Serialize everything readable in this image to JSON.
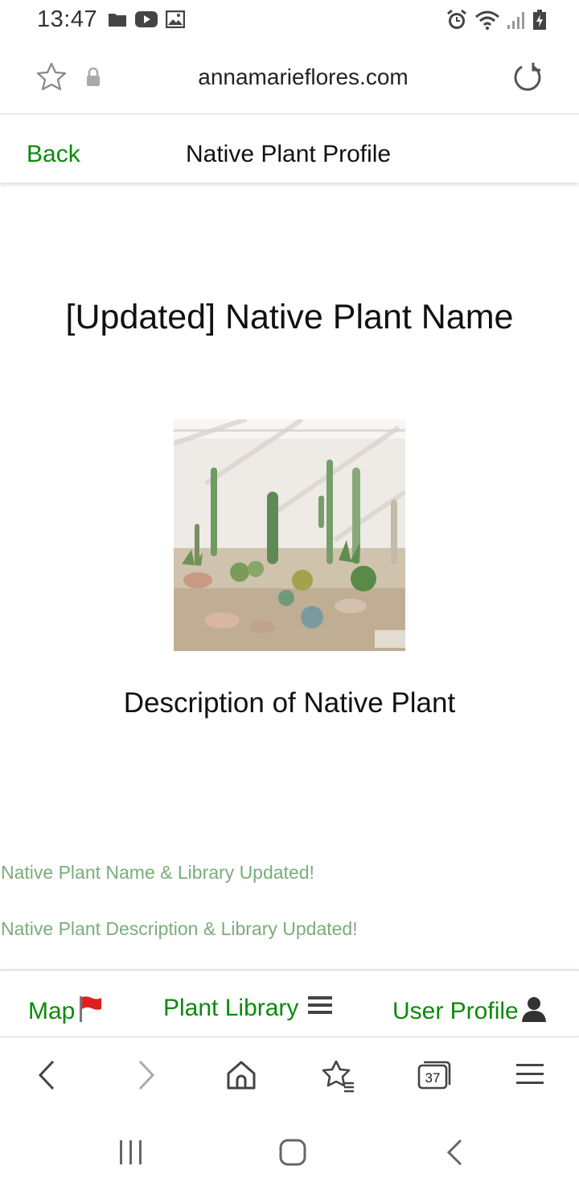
{
  "status_bar": {
    "time": "13:47",
    "left_icons": [
      "folder-icon",
      "youtube-icon",
      "image-icon"
    ],
    "right_icons": [
      "alarm-icon",
      "wifi-icon",
      "signal-icon",
      "battery-charging-icon"
    ]
  },
  "browser": {
    "url": "annamarieflores.com",
    "tab_count": "37"
  },
  "header": {
    "back_label": "Back",
    "title": "Native Plant Profile"
  },
  "main": {
    "plant_name": "[Updated] Native Plant Name",
    "description": "Description of Native Plant",
    "messages": [
      "Native Plant Name & Library Updated!",
      "Native Plant Description & Library Updated!"
    ]
  },
  "app_nav": {
    "items": [
      {
        "label": "Map",
        "icon": "red-flag-icon"
      },
      {
        "label": "Plant Library",
        "icon": "hamburger-icon"
      },
      {
        "label": "User Profile",
        "icon": "user-silhouette-icon"
      }
    ]
  },
  "colors": {
    "accent_green": "#0b8a0b",
    "message_green": "#7aad7a"
  }
}
